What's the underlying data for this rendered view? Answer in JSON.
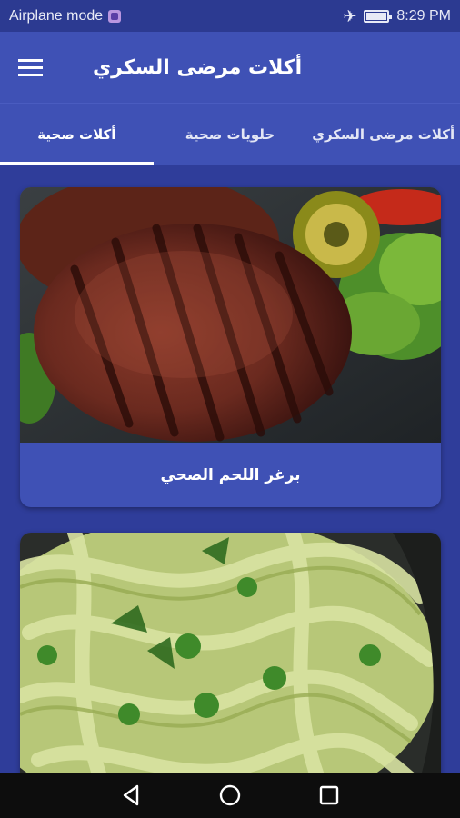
{
  "status_bar": {
    "mode_text": "Airplane mode",
    "time": "8:29 PM",
    "icons": [
      "notification-icon",
      "airplane-icon",
      "battery-icon"
    ]
  },
  "app_bar": {
    "title": "أكلات مرضى السكري",
    "menu_icon": "hamburger-menu-icon"
  },
  "tabs": [
    {
      "label": "أكلات صحية",
      "active": true
    },
    {
      "label": "حلويات صحية",
      "active": false
    },
    {
      "label": "أكلات مرضى السكري",
      "active": false
    }
  ],
  "cards": [
    {
      "label": "برغر اللحم الصحي",
      "image": "grilled-burger-patty-photo"
    },
    {
      "label": "",
      "image": "green-pesto-pasta-photo"
    }
  ],
  "nav_bar": {
    "icons": [
      "back-icon",
      "home-icon",
      "recents-icon"
    ]
  },
  "colors": {
    "primary": "#3f51b5",
    "background": "#2f3d9a",
    "status_bar": "#2c3a91",
    "nav_bar": "#0d0d0d"
  }
}
